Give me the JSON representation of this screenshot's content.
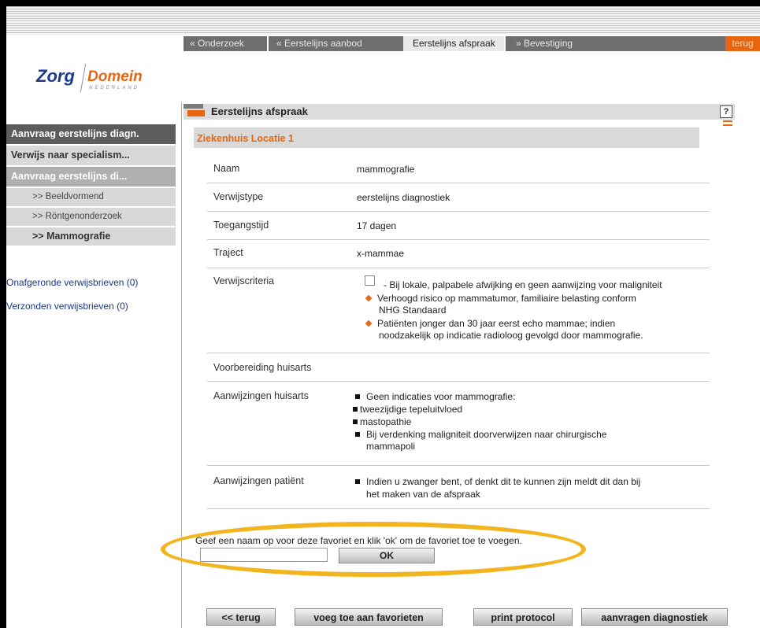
{
  "tabs": [
    {
      "label": "« Onderzoek"
    },
    {
      "label": "« Eerstelijns aanbod"
    },
    {
      "label": "Eerstelijns afspraak"
    },
    {
      "label": "» Bevestiging"
    }
  ],
  "terug_tab": "terug",
  "logo": {
    "zorg": "Zorg",
    "domein": "Domein",
    "subtitle": "NEDERLAND"
  },
  "sidebar": {
    "items": [
      {
        "label": "Aanvraag eerstelijns diagn."
      },
      {
        "label": "Verwijs naar specialism..."
      },
      {
        "label": "Aanvraag eerstelijns di..."
      },
      {
        "label": ">> Beeldvormend"
      },
      {
        "label": ">> Röntgenonderzoek"
      },
      {
        "label": ">> Mammografie"
      }
    ],
    "links": [
      {
        "label": "Onafgeronde verwijsbrieven (0)"
      },
      {
        "label": "Verzonden verwijsbrieven (0)"
      }
    ]
  },
  "section_title": "Eerstelijns afspraak",
  "help_label": "?",
  "location": "Ziekenhuis Locatie 1",
  "details": {
    "naam": {
      "label": "Naam",
      "value": "mammografie"
    },
    "verwijstype": {
      "label": "Verwijstype",
      "value": "eerstelijns diagnostiek"
    },
    "toegangstijd": {
      "label": "Toegangstijd",
      "value": "17 dagen"
    },
    "traject": {
      "label": "Traject",
      "value": "x-mammae"
    },
    "verwijscriteria": {
      "label": "Verwijscriteria",
      "checkbox_text": "- Bij lokale, palpabele afwijking en geen aanwijzing voor maligniteit",
      "bullet1": [
        "Verhoogd risico op mammatumor, familiaire belasting conform",
        "NHG Standaard"
      ],
      "bullet2": [
        "Patiënten jonger dan 30 jaar eerst echo mammae; indien",
        "noodzakelijk op indicatie radioloog gevolgd door mammografie."
      ]
    },
    "voorbereiding": {
      "label": "Voorbereiding huisarts"
    },
    "aanwijzingen_huisarts": {
      "label": "Aanwijzingen huisarts",
      "lines": [
        "Geen indicaties voor mammografie:",
        "tweezijdige tepeluitvloed",
        "mastopathie",
        "Bij verdenking maligniteit doorverwijzen naar chirurgische",
        "mammapoli"
      ]
    },
    "aanwijzingen_patient": {
      "label": "Aanwijzingen patiënt",
      "lines": [
        "Indien u zwanger bent, of denkt dit te kunnen zijn meldt dit dan bij",
        "het maken van de afspraak"
      ]
    }
  },
  "favorite": {
    "instruction": "Geef een naam op voor deze favoriet en klik 'ok' om de favoriet toe te voegen.",
    "input_value": "",
    "ok_label": "OK"
  },
  "buttons": {
    "back": "<< terug",
    "add_favorite": "voeg toe aan favorieten",
    "print": "print protocol",
    "request": "aanvragen diagnostiek"
  },
  "colors": {
    "accent": "#e8650e",
    "brand_blue": "#1a3a8c",
    "highlight": "#f2b51f"
  }
}
